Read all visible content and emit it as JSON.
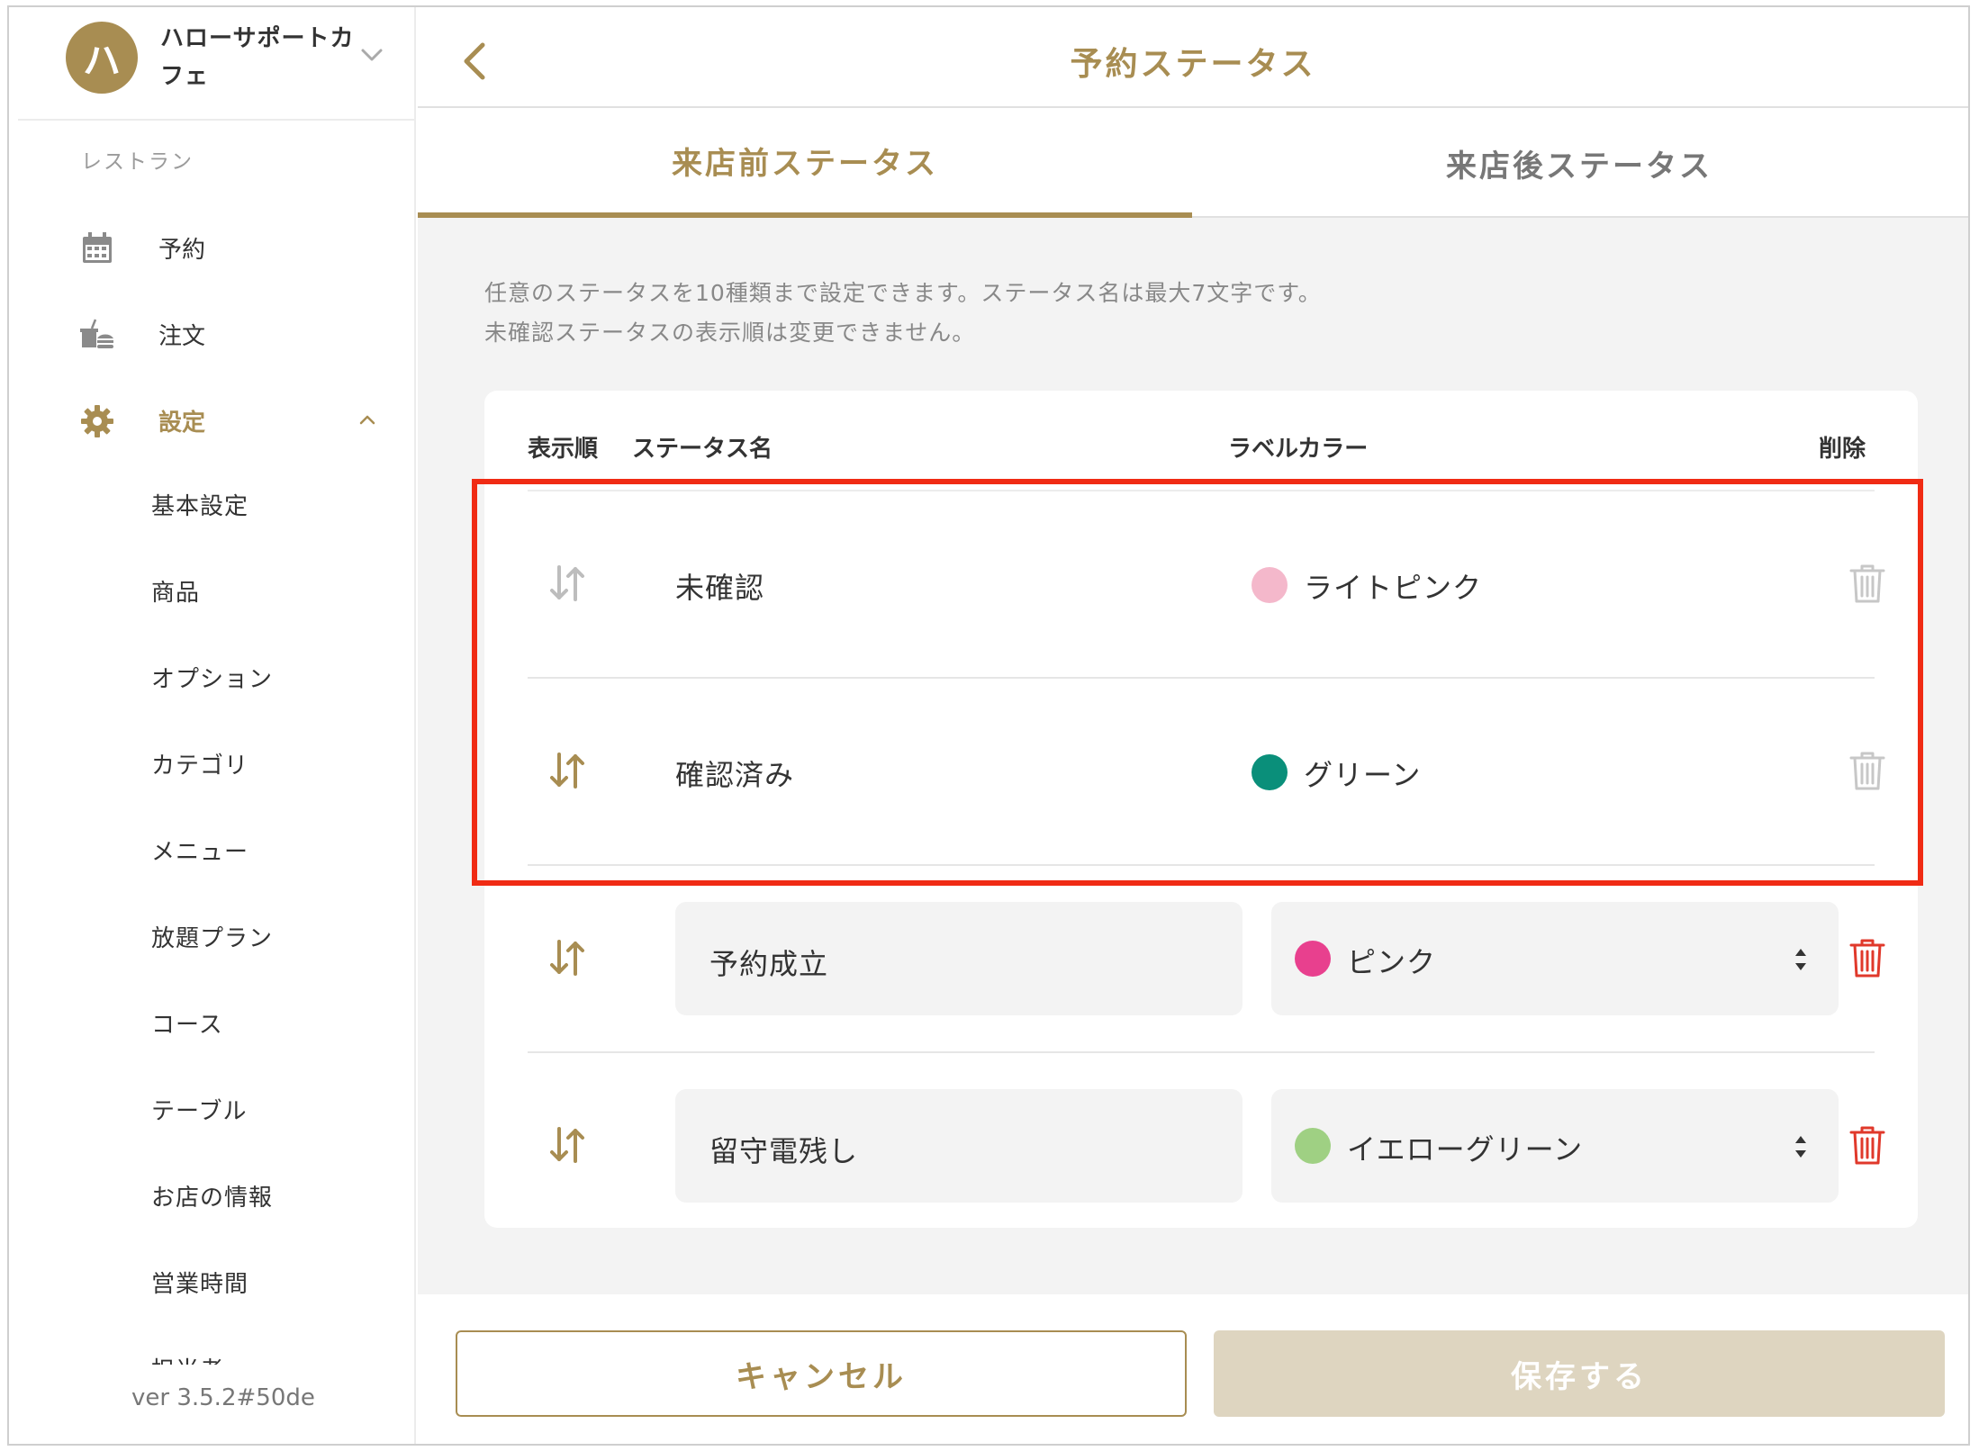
{
  "sidebar": {
    "shop": {
      "avatar_letter": "ハ",
      "name": "ハローサポートカフェ"
    },
    "section_label": "レストラン",
    "nav": [
      {
        "label": "予約",
        "icon": "calendar-icon"
      },
      {
        "label": "注文",
        "icon": "order-icon"
      },
      {
        "label": "設定",
        "icon": "gear-icon",
        "active": true,
        "expanded": true
      }
    ],
    "settings_items": [
      "基本設定",
      "商品",
      "オプション",
      "カテゴリ",
      "メニュー",
      "放題プラン",
      "コース",
      "テーブル",
      "お店の情報",
      "営業時間",
      "担当者"
    ],
    "version": "ver 3.5.2#50de"
  },
  "header": {
    "title": "予約ステータス"
  },
  "tabs": [
    {
      "label": "来店前ステータス",
      "active": true
    },
    {
      "label": "来店後ステータス",
      "active": false
    }
  ],
  "description": {
    "line1": "任意のステータスを10種類まで設定できます。ステータス名は最大7文字です。",
    "line2": "未確認ステータスの表示順は変更できません。"
  },
  "table": {
    "headers": {
      "order": "表示順",
      "name": "ステータス名",
      "color": "ラベルカラー",
      "delete": "削除"
    },
    "rows": [
      {
        "name": "未確認",
        "color_name": "ライトピンク",
        "color": "#f4b8cb",
        "editable": false
      },
      {
        "name": "確認済み",
        "color_name": "グリーン",
        "color": "#0a8f7a",
        "editable": false
      },
      {
        "name": "予約成立",
        "color_name": "ピンク",
        "color": "#e8408e",
        "editable": true
      },
      {
        "name": "留守電残し",
        "color_name": "イエローグリーン",
        "color": "#9fd083",
        "editable": true
      }
    ]
  },
  "footer": {
    "cancel_label": "キャンセル",
    "save_label": "保存する"
  },
  "theme": {
    "accent": "#a88d52",
    "highlight": "#f02b14",
    "danger": "#e0392b"
  }
}
